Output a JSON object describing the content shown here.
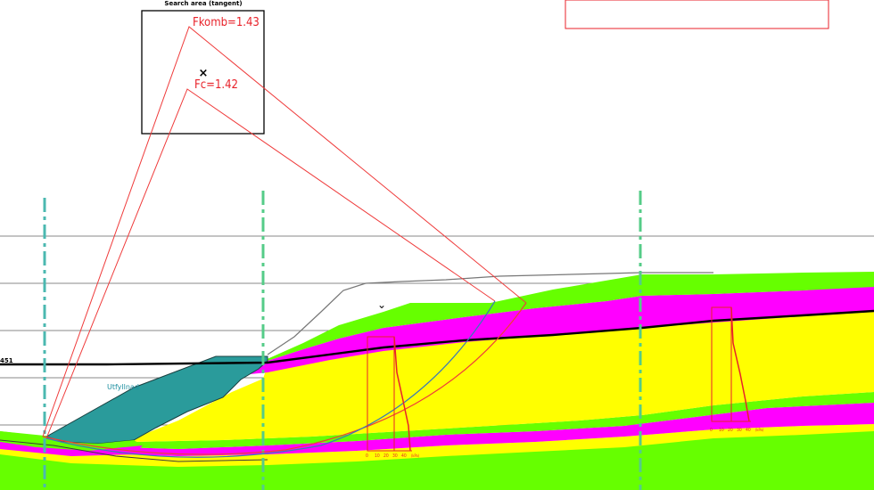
{
  "search_area": {
    "title": "Search area (tangent)"
  },
  "results": {
    "fkomb_label": "Fkomb=1.43",
    "fc_label": "Fc=1.42"
  },
  "layers": {
    "fill_label": "Utfyllnad"
  },
  "level_marker": {
    "label": "451"
  },
  "profile_1": {
    "scale_labels": [
      "0",
      "10",
      "20",
      "30",
      "40"
    ],
    "unit": "(kPa)"
  },
  "profile_2": {
    "scale_labels": [
      "0",
      "10",
      "20",
      "30",
      "40"
    ],
    "unit": "(kPa)"
  },
  "colors": {
    "yellow": "#ffff00",
    "magenta": "#ff00ff",
    "green": "#66ff00",
    "teal_fill": "#2a9b9b",
    "red_line": "#ef3b3b",
    "slip_blue": "#3a78b8",
    "gridline": "#8a8a8a",
    "dashdot_1": "#4bb8b0",
    "dashdot_2": "#55cc88"
  },
  "icons": {
    "search_center": "x-mark-icon",
    "chevron": "chevron-down-icon"
  }
}
